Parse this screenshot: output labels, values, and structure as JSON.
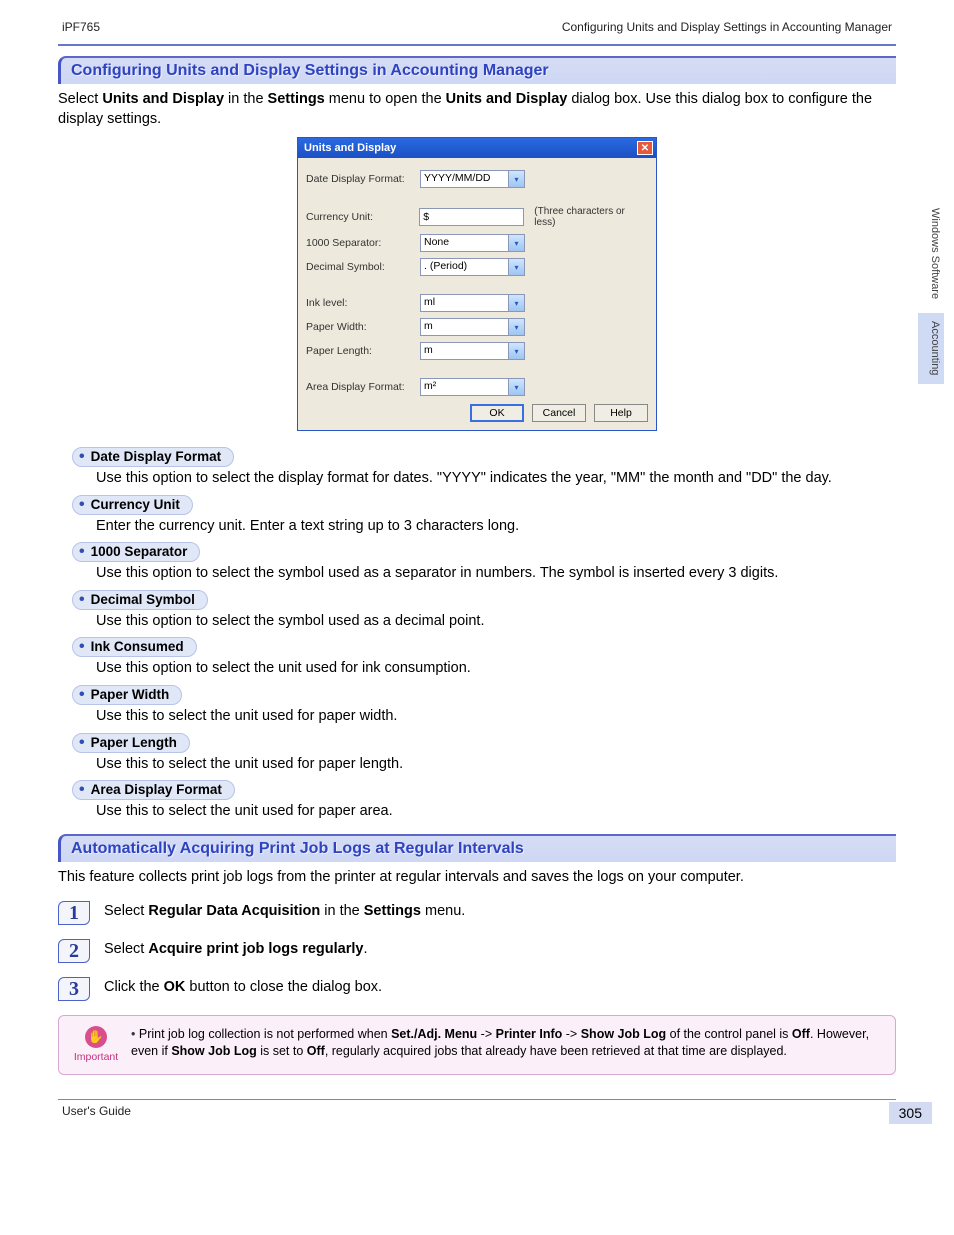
{
  "header": {
    "left": "iPF765",
    "right": "Configuring Units and Display Settings in Accounting Manager"
  },
  "section1": {
    "title": "Configuring Units and Display Settings in Accounting Manager",
    "intro_pre": "Select ",
    "intro_b1": "Units and Display",
    "intro_mid1": " in the ",
    "intro_b2": "Settings",
    "intro_mid2": " menu to open the ",
    "intro_b3": "Units and Display",
    "intro_post": " dialog box. Use this dialog box to configure the display settings."
  },
  "dialog": {
    "title": "Units and Display",
    "rows": {
      "date": {
        "label": "Date Display Format:",
        "value": "YYYY/MM/DD"
      },
      "currency": {
        "label": "Currency Unit:",
        "value": "$",
        "trailer": "(Three characters or less)"
      },
      "sep": {
        "label": "1000 Separator:",
        "value": "None"
      },
      "decimal": {
        "label": "Decimal Symbol:",
        "value": ". (Period)"
      },
      "ink": {
        "label": "Ink level:",
        "value": "ml"
      },
      "pwidth": {
        "label": "Paper Width:",
        "value": "m"
      },
      "plength": {
        "label": "Paper Length:",
        "value": "m"
      },
      "area": {
        "label": "Area Display Format:",
        "value": "m²"
      }
    },
    "buttons": {
      "ok": "OK",
      "cancel": "Cancel",
      "help": "Help"
    }
  },
  "bullets": [
    {
      "title": "Date Display Format",
      "desc": "Use this option to select the display format for dates. \"YYYY\" indicates the year, \"MM\" the month and \"DD\" the day."
    },
    {
      "title": "Currency Unit",
      "desc": "Enter the currency unit. Enter a text string up to 3 characters long."
    },
    {
      "title": "1000 Separator",
      "desc": "Use this option to select the symbol used as a separator in numbers. The symbol is inserted every 3 digits."
    },
    {
      "title": "Decimal Symbol",
      "desc": "Use this option to select the symbol used as a decimal point."
    },
    {
      "title": "Ink Consumed",
      "desc": "Use this option to select the unit used for ink consumption."
    },
    {
      "title": "Paper Width",
      "desc": "Use this to select the unit used for paper width."
    },
    {
      "title": "Paper Length",
      "desc": "Use this to select the unit used for paper length."
    },
    {
      "title": "Area Display Format",
      "desc": "Use this to select the unit used for paper area."
    }
  ],
  "section2": {
    "title": "Automatically Acquiring Print Job Logs at Regular Intervals",
    "intro": "This feature collects print job logs from the printer at regular intervals and saves the logs on your computer."
  },
  "steps": {
    "s1_pre": "Select ",
    "s1_b1": "Regular Data Acquisition",
    "s1_mid": " in the ",
    "s1_b2": "Settings",
    "s1_post": " menu.",
    "s2_pre": "Select ",
    "s2_b1": "Acquire print job logs regularly",
    "s2_post": ".",
    "s3_pre": "Click the ",
    "s3_b1": "OK",
    "s3_post": " button to close the dialog box."
  },
  "note": {
    "label": "Important",
    "pre": "Print job log collection is not performed when ",
    "b1": "Set./Adj. Menu",
    "a1": " -> ",
    "b2": "Printer Info",
    "a2": " -> ",
    "b3": "Show Job Log",
    "mid1": " of the control panel is ",
    "b4": "Off",
    "mid2": ". However, even if ",
    "b5": "Show Job Log",
    "mid3": " is set to ",
    "b6": "Off",
    "post": ", regularly acquired jobs that already have been retrieved at that time are displayed."
  },
  "sidetabs": {
    "t1": "Windows Software",
    "t2": "Accounting"
  },
  "page_number": "305",
  "footer": "User's Guide"
}
